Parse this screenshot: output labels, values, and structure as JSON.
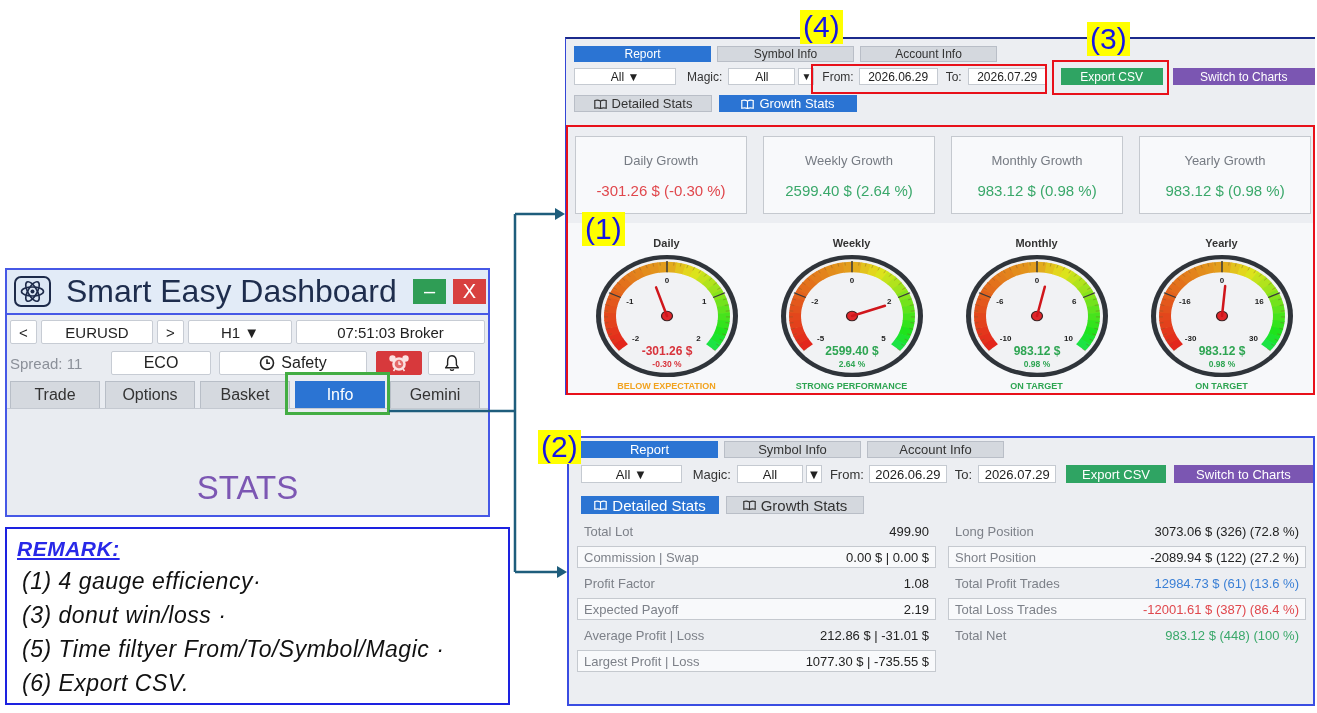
{
  "dashboard": {
    "title": "Smart Easy Dashboard",
    "window_controls": [
      {
        "kind": "minimize",
        "label": "–"
      },
      {
        "kind": "close",
        "label": "X"
      }
    ],
    "symbol_bar": [
      {
        "kind": "nav",
        "label": "<"
      },
      {
        "kind": "symbol",
        "label": "EURUSD"
      },
      {
        "kind": "nav",
        "label": ">"
      },
      {
        "kind": "timeframe",
        "label": "H1 ▼"
      },
      {
        "kind": "clock",
        "label": "07:51:03 Broker"
      }
    ],
    "spread": "Spread: 11",
    "mode_buttons": [
      {
        "kind": "mode",
        "label": "ECO",
        "active": false
      },
      {
        "kind": "timer",
        "label": "Safety",
        "active": false
      },
      {
        "kind": "alarm",
        "active": true
      },
      {
        "kind": "bell",
        "active": false
      }
    ],
    "tabs": [
      {
        "label": "Trade",
        "selected": false,
        "highlighted": false
      },
      {
        "label": "Options",
        "selected": false,
        "highlighted": false
      },
      {
        "label": "Basket",
        "selected": false,
        "highlighted": false
      },
      {
        "label": "Info",
        "selected": true,
        "highlighted": true
      },
      {
        "label": "Gemini",
        "selected": false,
        "highlighted": false
      }
    ],
    "content_title": "STATS"
  },
  "remark": {
    "heading": "REMARK:",
    "lines": [
      "(1) 4 gauge efficiency·",
      "(3) donut win/loss ·",
      "(5) Time filtyer From/To/Symbol/Magic ·",
      "(6) Export CSV."
    ]
  },
  "growth_panel": {
    "report_tabs": [
      {
        "label": "Report",
        "selected": true
      },
      {
        "label": "Symbol Info",
        "selected": false
      },
      {
        "label": "Account Info",
        "selected": false
      }
    ],
    "filters": {
      "symbol": "All ▼",
      "magic_label": "Magic:",
      "magic": "All",
      "magic_toggle": "▼",
      "from_label": "From:",
      "from": "2026.06.29",
      "to_label": "To:",
      "to": "2026.07.29"
    },
    "actions": [
      {
        "kind": "export",
        "label": "Export CSV"
      },
      {
        "kind": "switch",
        "label": "Switch to Charts"
      }
    ],
    "view_tabs": [
      {
        "label": "Detailed Stats",
        "selected": false
      },
      {
        "label": "Growth Stats",
        "selected": true
      }
    ],
    "callouts": [
      {
        "kind": "dates",
        "label": "(4)"
      },
      {
        "kind": "export",
        "label": "(3)"
      },
      {
        "kind": "growth",
        "label": "(1)"
      }
    ],
    "cards": [
      {
        "title": "Daily Growth",
        "value": "-301.26 $ (-0.30 %)",
        "color": "#e0474c"
      },
      {
        "title": "Weekly Growth",
        "value": "2599.40 $ (2.64 %)",
        "color": "#3aa86a"
      },
      {
        "title": "Monthly Growth",
        "value": "983.12 $ (0.98 %)",
        "color": "#3aa86a"
      },
      {
        "title": "Yearly Growth",
        "value": "983.12 $ (0.98 %)",
        "color": "#3aa86a"
      }
    ],
    "gauges": [
      {
        "title": "Daily",
        "ticks": [
          "-2",
          "-1",
          "0",
          "1",
          "2"
        ],
        "level": 0.43,
        "value": "-301.26 $",
        "percent": "-0.30 %",
        "color": "#d8343c",
        "status": {
          "label": "BELOW EXPECTATION",
          "color": "#f2a31f"
        }
      },
      {
        "title": "Weekly",
        "ticks": [
          "-5",
          "-2",
          "0",
          "2",
          "5"
        ],
        "level": 0.77,
        "value": "2599.40 $",
        "percent": "2.64 %",
        "color": "#2ea552",
        "status": {
          "label": "STRONG PERFORMANCE",
          "color": "#2ea552"
        }
      },
      {
        "title": "Monthly",
        "ticks": [
          "-10",
          "-6",
          "0",
          "6",
          "10"
        ],
        "level": 0.55,
        "value": "983.12 $",
        "percent": "0.98 %",
        "color": "#2ea552",
        "status": {
          "label": "ON TARGET",
          "color": "#2ea552"
        }
      },
      {
        "title": "Yearly",
        "ticks": [
          "-30",
          "-16",
          "0",
          "16",
          "30"
        ],
        "level": 0.52,
        "value": "983.12 $",
        "percent": "0.98 %",
        "color": "#2ea552",
        "status": {
          "label": "ON TARGET",
          "color": "#2ea552"
        }
      }
    ]
  },
  "stats_panel": {
    "report_tabs": [
      {
        "label": "Report",
        "selected": true
      },
      {
        "label": "Symbol Info",
        "selected": false
      },
      {
        "label": "Account Info",
        "selected": false
      }
    ],
    "filters": {
      "symbol": "All ▼",
      "magic_label": "Magic:",
      "magic": "All",
      "magic_toggle": "▼",
      "from_label": "From:",
      "from": "2026.06.29",
      "to_label": "To:",
      "to": "2026.07.29"
    },
    "actions": [
      {
        "kind": "export",
        "label": "Export CSV"
      },
      {
        "kind": "switch",
        "label": "Switch to Charts"
      }
    ],
    "view_tabs": [
      {
        "label": "Detailed Stats",
        "selected": true
      },
      {
        "label": "Growth Stats",
        "selected": false
      }
    ],
    "callouts": [
      {
        "kind": "stats",
        "label": "(2)"
      }
    ],
    "stats": {
      "left": [
        {
          "label": "Total Lot",
          "value": "499.90"
        },
        {
          "label": "Commission | Swap",
          "value": "0.00 $ | 0.00 $"
        },
        {
          "label": "Profit Factor",
          "value": "1.08"
        },
        {
          "label": "Expected Payoff",
          "value": "2.19"
        },
        {
          "label": "Average Profit | Loss",
          "value": "212.86 $ | -31.01 $"
        },
        {
          "label": "Largest Profit | Loss",
          "value": "1077.30 $ | -735.55 $"
        }
      ],
      "right": [
        {
          "label": "Long Position",
          "value": "3073.06 $ (326) (72.8 %)",
          "color": "#222222"
        },
        {
          "label": "Short Position",
          "value": "-2089.94 $ (122) (27.2 %)",
          "color": "#222222"
        },
        {
          "label": "Total Profit Trades",
          "value": "12984.73 $ (61) (13.6 %)",
          "color": "#3a7fd5"
        },
        {
          "label": "Total Loss Trades",
          "value": "-12001.61 $ (387) (86.4 %)",
          "color": "#e0474c"
        },
        {
          "label": "Total Net",
          "value": "983.12 $ (448) (100 %)",
          "color": "#3aa86a"
        }
      ]
    }
  }
}
